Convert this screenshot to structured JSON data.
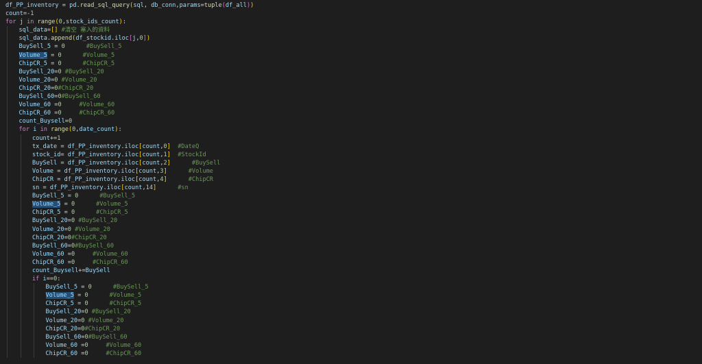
{
  "editor": {
    "language": "python",
    "theme_colors": {
      "background": "#1e1e1e",
      "keyword": "#c586c0",
      "variable": "#9cdcfe",
      "function": "#dcdcaa",
      "number": "#b5cea8",
      "comment": "#6a9955",
      "bracket_1": "#ffd700",
      "bracket_2": "#da70d6",
      "bracket_3": "#179fff",
      "selection_highlight": "#264f78"
    },
    "lines": [
      {
        "indent": 0,
        "tokens": [
          [
            "df_PP_inventory",
            "var"
          ],
          [
            " = ",
            "op"
          ],
          [
            "pd",
            "var"
          ],
          [
            ".",
            "op"
          ],
          [
            "read_sql_query",
            "fn"
          ],
          [
            "(",
            "p1"
          ],
          [
            "sql",
            "var"
          ],
          [
            ", ",
            "op"
          ],
          [
            "db_conn",
            "var"
          ],
          [
            ",",
            "op"
          ],
          [
            "params",
            "var"
          ],
          [
            "=",
            "op"
          ],
          [
            "tuple",
            "fn"
          ],
          [
            "(",
            "p2"
          ],
          [
            "df_all",
            "var"
          ],
          [
            ")",
            "p2"
          ],
          [
            ")",
            "p1"
          ]
        ]
      },
      {
        "indent": 0,
        "tokens": [
          [
            "count",
            "var"
          ],
          [
            "=",
            "op"
          ],
          [
            "-1",
            "num"
          ]
        ]
      },
      {
        "indent": 0,
        "tokens": [
          [
            "for",
            "kw"
          ],
          [
            " ",
            "op"
          ],
          [
            "j",
            "var"
          ],
          [
            " in ",
            "kw"
          ],
          [
            "range",
            "fn"
          ],
          [
            "(",
            "p1"
          ],
          [
            "0",
            "num"
          ],
          [
            ",",
            "op"
          ],
          [
            "stock_ids_count",
            "var"
          ],
          [
            ")",
            "p1"
          ],
          [
            ":",
            "op"
          ]
        ]
      },
      {
        "indent": 1,
        "tokens": [
          [
            "sql_data",
            "var"
          ],
          [
            "=",
            "op"
          ],
          [
            "[]",
            "p1"
          ],
          [
            " #清空 塞入的資料",
            "cm"
          ]
        ]
      },
      {
        "indent": 1,
        "tokens": [
          [
            "sql_data",
            "var"
          ],
          [
            ".",
            "op"
          ],
          [
            "append",
            "fn"
          ],
          [
            "(",
            "p1"
          ],
          [
            "df_stockid",
            "var"
          ],
          [
            ".",
            "op"
          ],
          [
            "iloc",
            "var"
          ],
          [
            "[",
            "p2"
          ],
          [
            "j",
            "var"
          ],
          [
            ",",
            "op"
          ],
          [
            "0",
            "num"
          ],
          [
            "]",
            "p2"
          ],
          [
            ")",
            "p1"
          ]
        ]
      },
      {
        "indent": 1,
        "tokens": [
          [
            "BuySell_5",
            "var"
          ],
          [
            " = ",
            "op"
          ],
          [
            "0",
            "num"
          ],
          [
            "      #BuySell_5",
            "cm"
          ]
        ]
      },
      {
        "indent": 1,
        "tokens": [
          [
            "Volume_5",
            "hl"
          ],
          [
            " = ",
            "op"
          ],
          [
            "0",
            "num"
          ],
          [
            "      #Volume_5",
            "cm"
          ]
        ]
      },
      {
        "indent": 1,
        "tokens": [
          [
            "ChipCR_5",
            "var"
          ],
          [
            " = ",
            "op"
          ],
          [
            "0",
            "num"
          ],
          [
            "      #ChipCR_5",
            "cm"
          ]
        ]
      },
      {
        "indent": 1,
        "tokens": [
          [
            "BuySell_20",
            "var"
          ],
          [
            "=",
            "op"
          ],
          [
            "0",
            "num"
          ],
          [
            " #BuySell_20",
            "cm"
          ]
        ]
      },
      {
        "indent": 1,
        "tokens": [
          [
            "Volume_20",
            "var"
          ],
          [
            "=",
            "op"
          ],
          [
            "0",
            "num"
          ],
          [
            " #Volume_20",
            "cm"
          ]
        ]
      },
      {
        "indent": 1,
        "tokens": [
          [
            "ChipCR_20",
            "var"
          ],
          [
            "=",
            "op"
          ],
          [
            "0",
            "num"
          ],
          [
            "#ChipCR_20",
            "cm"
          ]
        ]
      },
      {
        "indent": 1,
        "tokens": [
          [
            "BuySell_60",
            "var"
          ],
          [
            "=",
            "op"
          ],
          [
            "0",
            "num"
          ],
          [
            "#BuySell_60",
            "cm"
          ]
        ]
      },
      {
        "indent": 1,
        "tokens": [
          [
            "Volume_60",
            "var"
          ],
          [
            " =",
            "op"
          ],
          [
            "0",
            "num"
          ],
          [
            "     #Volume_60",
            "cm"
          ]
        ]
      },
      {
        "indent": 1,
        "tokens": [
          [
            "ChipCR_60",
            "var"
          ],
          [
            " =",
            "op"
          ],
          [
            "0",
            "num"
          ],
          [
            "     #ChipCR_60",
            "cm"
          ]
        ]
      },
      {
        "indent": 1,
        "tokens": [
          [
            "count_Buysell",
            "var"
          ],
          [
            "=",
            "op"
          ],
          [
            "0",
            "num"
          ]
        ]
      },
      {
        "indent": 1,
        "tokens": [
          [
            "for",
            "kw"
          ],
          [
            " ",
            "op"
          ],
          [
            "i",
            "var"
          ],
          [
            " in ",
            "kw"
          ],
          [
            "range",
            "fn"
          ],
          [
            "(",
            "p1"
          ],
          [
            "0",
            "num"
          ],
          [
            ",",
            "op"
          ],
          [
            "date_count",
            "var"
          ],
          [
            ")",
            "p1"
          ],
          [
            ":",
            "op"
          ]
        ]
      },
      {
        "indent": 2,
        "tokens": [
          [
            "count",
            "var"
          ],
          [
            "+=",
            "op"
          ],
          [
            "1",
            "num"
          ]
        ]
      },
      {
        "indent": 2,
        "tokens": [
          [
            "tx_date",
            "var"
          ],
          [
            " = ",
            "op"
          ],
          [
            "df_PP_inventory",
            "var"
          ],
          [
            ".",
            "op"
          ],
          [
            "iloc",
            "var"
          ],
          [
            "[",
            "p1"
          ],
          [
            "count",
            "var"
          ],
          [
            ",",
            "op"
          ],
          [
            "0",
            "num"
          ],
          [
            "]",
            "p1"
          ],
          [
            "  #DateQ",
            "cm"
          ]
        ]
      },
      {
        "indent": 2,
        "tokens": [
          [
            "stock_id",
            "var"
          ],
          [
            "= ",
            "op"
          ],
          [
            "df_PP_inventory",
            "var"
          ],
          [
            ".",
            "op"
          ],
          [
            "iloc",
            "var"
          ],
          [
            "[",
            "p1"
          ],
          [
            "count",
            "var"
          ],
          [
            ",",
            "op"
          ],
          [
            "1",
            "num"
          ],
          [
            "]",
            "p1"
          ],
          [
            "  #StockId",
            "cm"
          ]
        ]
      },
      {
        "indent": 2,
        "tokens": [
          [
            "BuySell",
            "var"
          ],
          [
            " = ",
            "op"
          ],
          [
            "df_PP_inventory",
            "var"
          ],
          [
            ".",
            "op"
          ],
          [
            "iloc",
            "var"
          ],
          [
            "[",
            "p1"
          ],
          [
            "count",
            "var"
          ],
          [
            ",",
            "op"
          ],
          [
            "2",
            "num"
          ],
          [
            "]",
            "p1"
          ],
          [
            "      #BuySell",
            "cm"
          ]
        ]
      },
      {
        "indent": 2,
        "tokens": [
          [
            "Volume",
            "var"
          ],
          [
            " = ",
            "op"
          ],
          [
            "df_PP_inventory",
            "var"
          ],
          [
            ".",
            "op"
          ],
          [
            "iloc",
            "var"
          ],
          [
            "[",
            "p1"
          ],
          [
            "count",
            "var"
          ],
          [
            ",",
            "op"
          ],
          [
            "3",
            "num"
          ],
          [
            "]",
            "p1"
          ],
          [
            "      #Volume",
            "cm"
          ]
        ]
      },
      {
        "indent": 2,
        "tokens": [
          [
            "ChipCR",
            "var"
          ],
          [
            " = ",
            "op"
          ],
          [
            "df_PP_inventory",
            "var"
          ],
          [
            ".",
            "op"
          ],
          [
            "iloc",
            "var"
          ],
          [
            "[",
            "p1"
          ],
          [
            "count",
            "var"
          ],
          [
            ",",
            "op"
          ],
          [
            "4",
            "num"
          ],
          [
            "]",
            "p1"
          ],
          [
            "      #ChipCR",
            "cm"
          ]
        ]
      },
      {
        "indent": 2,
        "tokens": [
          [
            "sn",
            "var"
          ],
          [
            " = ",
            "op"
          ],
          [
            "df_PP_inventory",
            "var"
          ],
          [
            ".",
            "op"
          ],
          [
            "iloc",
            "var"
          ],
          [
            "[",
            "p1"
          ],
          [
            "count",
            "var"
          ],
          [
            ",",
            "op"
          ],
          [
            "14",
            "num"
          ],
          [
            "]",
            "p1"
          ],
          [
            "      #sn",
            "cm"
          ]
        ]
      },
      {
        "indent": 2,
        "tokens": [
          [
            "BuySell_5",
            "var"
          ],
          [
            " = ",
            "op"
          ],
          [
            "0",
            "num"
          ],
          [
            "      #BuySell_5",
            "cm"
          ]
        ]
      },
      {
        "indent": 2,
        "tokens": [
          [
            "Volume_5",
            "hl"
          ],
          [
            " = ",
            "op"
          ],
          [
            "0",
            "num"
          ],
          [
            "      #Volume_5",
            "cm"
          ]
        ]
      },
      {
        "indent": 2,
        "tokens": [
          [
            "ChipCR_5",
            "var"
          ],
          [
            " = ",
            "op"
          ],
          [
            "0",
            "num"
          ],
          [
            "      #ChipCR_5",
            "cm"
          ]
        ]
      },
      {
        "indent": 2,
        "tokens": [
          [
            "BuySell_20",
            "var"
          ],
          [
            "=",
            "op"
          ],
          [
            "0",
            "num"
          ],
          [
            " #BuySell_20",
            "cm"
          ]
        ]
      },
      {
        "indent": 2,
        "tokens": [
          [
            "Volume_20",
            "var"
          ],
          [
            "=",
            "op"
          ],
          [
            "0",
            "num"
          ],
          [
            " #Volume_20",
            "cm"
          ]
        ]
      },
      {
        "indent": 2,
        "tokens": [
          [
            "ChipCR_20",
            "var"
          ],
          [
            "=",
            "op"
          ],
          [
            "0",
            "num"
          ],
          [
            "#ChipCR_20",
            "cm"
          ]
        ]
      },
      {
        "indent": 2,
        "tokens": [
          [
            "BuySell_60",
            "var"
          ],
          [
            "=",
            "op"
          ],
          [
            "0",
            "num"
          ],
          [
            "#BuySell_60",
            "cm"
          ]
        ]
      },
      {
        "indent": 2,
        "tokens": [
          [
            "Volume_60",
            "var"
          ],
          [
            " =",
            "op"
          ],
          [
            "0",
            "num"
          ],
          [
            "     #Volume_60",
            "cm"
          ]
        ]
      },
      {
        "indent": 2,
        "tokens": [
          [
            "ChipCR_60",
            "var"
          ],
          [
            " =",
            "op"
          ],
          [
            "0",
            "num"
          ],
          [
            "     #ChipCR_60",
            "cm"
          ]
        ]
      },
      {
        "indent": 2,
        "tokens": [
          [
            "count_Buysell",
            "var"
          ],
          [
            "+=",
            "op"
          ],
          [
            "BuySell",
            "var"
          ]
        ]
      },
      {
        "indent": 2,
        "tokens": [
          [
            "if",
            "kw"
          ],
          [
            " ",
            "op"
          ],
          [
            "i",
            "var"
          ],
          [
            "==",
            "op"
          ],
          [
            "0",
            "num"
          ],
          [
            ":",
            "op"
          ]
        ]
      },
      {
        "indent": 3,
        "tokens": [
          [
            "BuySell_5",
            "var"
          ],
          [
            " = ",
            "op"
          ],
          [
            "0",
            "num"
          ],
          [
            "      #BuySell_5",
            "cm"
          ]
        ]
      },
      {
        "indent": 3,
        "tokens": [
          [
            "Volume_5",
            "hl"
          ],
          [
            " = ",
            "op"
          ],
          [
            "0",
            "num"
          ],
          [
            "      #Volume_5",
            "cm"
          ]
        ]
      },
      {
        "indent": 3,
        "tokens": [
          [
            "ChipCR_5",
            "var"
          ],
          [
            " = ",
            "op"
          ],
          [
            "0",
            "num"
          ],
          [
            "      #ChipCR_5",
            "cm"
          ]
        ]
      },
      {
        "indent": 3,
        "tokens": [
          [
            "BuySell_20",
            "var"
          ],
          [
            "=",
            "op"
          ],
          [
            "0",
            "num"
          ],
          [
            " #BuySell_20",
            "cm"
          ]
        ]
      },
      {
        "indent": 3,
        "tokens": [
          [
            "Volume_20",
            "var"
          ],
          [
            "=",
            "op"
          ],
          [
            "0",
            "num"
          ],
          [
            " #Volume_20",
            "cm"
          ]
        ]
      },
      {
        "indent": 3,
        "tokens": [
          [
            "ChipCR_20",
            "var"
          ],
          [
            "=",
            "op"
          ],
          [
            "0",
            "num"
          ],
          [
            "#ChipCR_20",
            "cm"
          ]
        ]
      },
      {
        "indent": 3,
        "tokens": [
          [
            "BuySell_60",
            "var"
          ],
          [
            "=",
            "op"
          ],
          [
            "0",
            "num"
          ],
          [
            "#BuySell_60",
            "cm"
          ]
        ]
      },
      {
        "indent": 3,
        "tokens": [
          [
            "Volume_60",
            "var"
          ],
          [
            " =",
            "op"
          ],
          [
            "0",
            "num"
          ],
          [
            "     #Volume_60",
            "cm"
          ]
        ]
      },
      {
        "indent": 3,
        "tokens": [
          [
            "ChipCR_60",
            "var"
          ],
          [
            " =",
            "op"
          ],
          [
            "0",
            "num"
          ],
          [
            "     #ChipCR_60",
            "cm"
          ]
        ]
      }
    ]
  }
}
